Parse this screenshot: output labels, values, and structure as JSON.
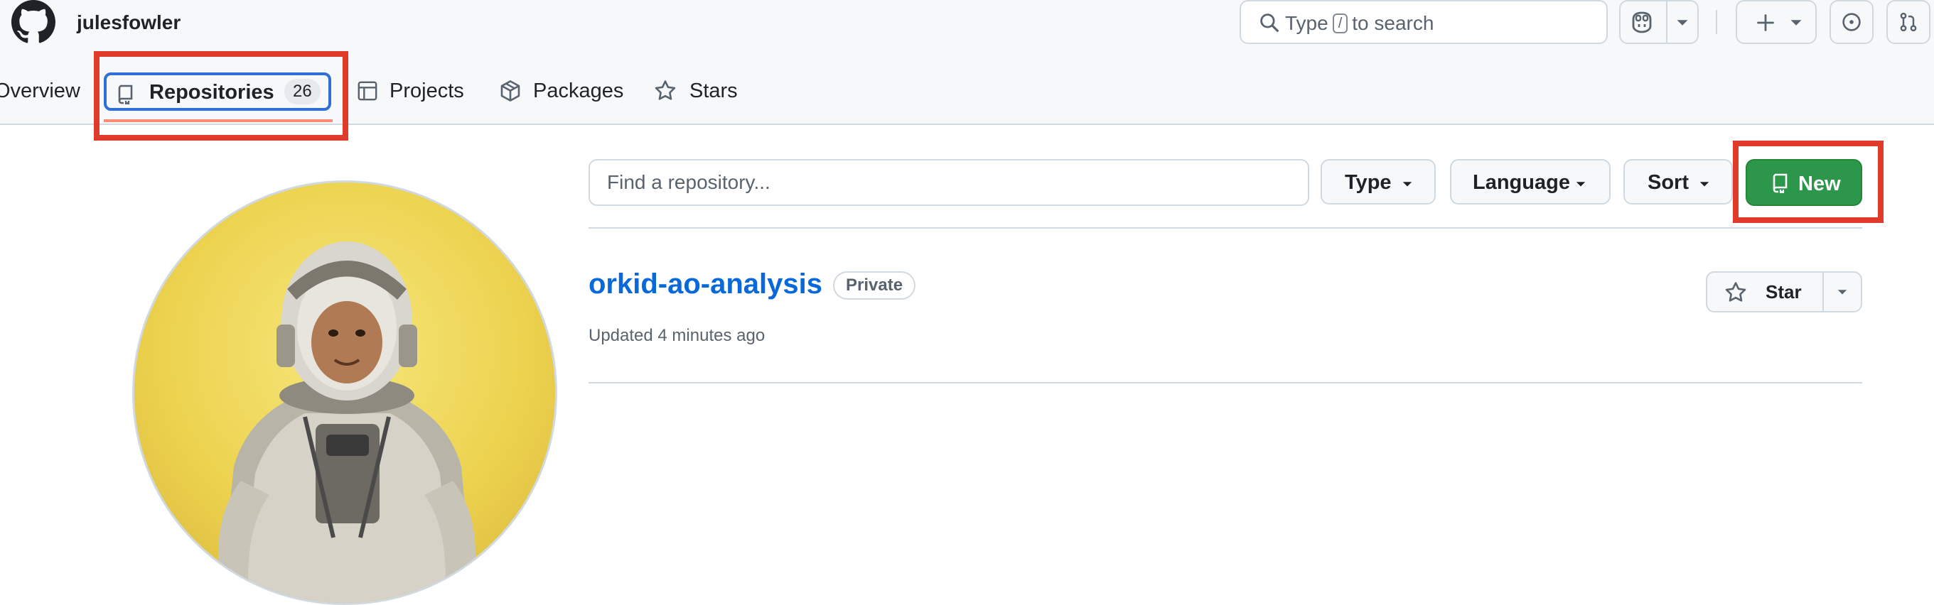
{
  "header": {
    "username": "julesfowler",
    "search": {
      "prefix": "Type",
      "key": "/",
      "suffix": "to search"
    }
  },
  "tabs": [
    {
      "label": "Overview"
    },
    {
      "label": "Repositories",
      "count": "26",
      "selected": true
    },
    {
      "label": "Projects"
    },
    {
      "label": "Packages"
    },
    {
      "label": "Stars"
    }
  ],
  "filters": {
    "search_placeholder": "Find a repository...",
    "type_label": "Type",
    "language_label": "Language",
    "sort_label": "Sort",
    "new_label": "New"
  },
  "repos": [
    {
      "name": "orkid-ao-analysis",
      "visibility": "Private",
      "updated": "Updated 4 minutes ago",
      "star_label": "Star"
    }
  ],
  "colors": {
    "accent_blue": "#0969da",
    "new_button_green": "#2c974b",
    "highlight_red": "#e03a2b",
    "tab_underline": "#fd8c73"
  },
  "icons": [
    "github-logo-icon",
    "search-icon",
    "copilot-icon",
    "plus-icon",
    "issue-icon",
    "pull-request-icon",
    "repo-icon",
    "table-icon",
    "package-icon",
    "star-icon",
    "caret-down-icon"
  ]
}
